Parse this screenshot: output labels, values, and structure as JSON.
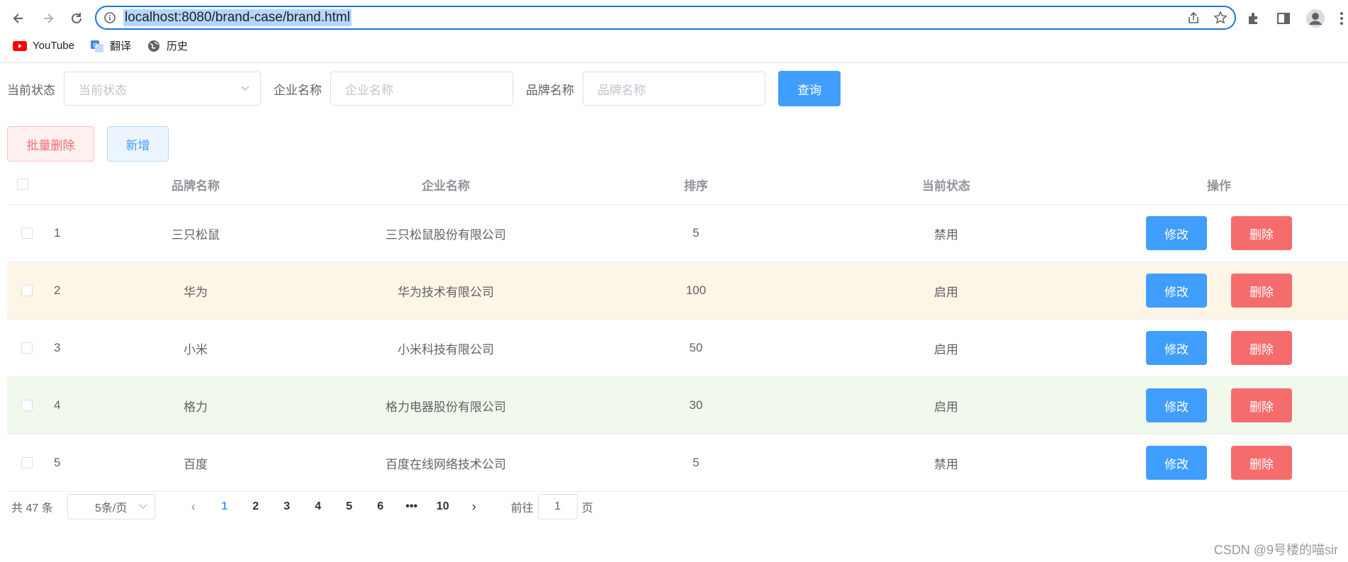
{
  "browser": {
    "url": "localhost:8080/brand-case/brand.html",
    "bookmarks": [
      {
        "label": "YouTube",
        "icon": "youtube-icon"
      },
      {
        "label": "翻译",
        "icon": "translate-icon"
      },
      {
        "label": "历史",
        "icon": "globe-icon"
      }
    ]
  },
  "search_form": {
    "status_label": "当前状态",
    "status_placeholder": "当前状态",
    "company_label": "企业名称",
    "company_placeholder": "企业名称",
    "brand_label": "品牌名称",
    "brand_placeholder": "品牌名称",
    "query_button": "查询"
  },
  "toolbar": {
    "batch_delete": "批量删除",
    "add": "新增"
  },
  "table": {
    "headers": {
      "brand": "品牌名称",
      "company": "企业名称",
      "order": "排序",
      "status": "当前状态",
      "ops": "操作"
    },
    "edit_label": "修改",
    "delete_label": "删除",
    "rows": [
      {
        "index": "1",
        "brand": "三只松鼠",
        "company": "三只松鼠股份有限公司",
        "order": "5",
        "status": "禁用"
      },
      {
        "index": "2",
        "brand": "华为",
        "company": "华为技术有限公司",
        "order": "100",
        "status": "启用"
      },
      {
        "index": "3",
        "brand": "小米",
        "company": "小米科技有限公司",
        "order": "50",
        "status": "启用"
      },
      {
        "index": "4",
        "brand": "格力",
        "company": "格力电器股份有限公司",
        "order": "30",
        "status": "启用"
      },
      {
        "index": "5",
        "brand": "百度",
        "company": "百度在线网络技术公司",
        "order": "5",
        "status": "禁用"
      }
    ]
  },
  "pagination": {
    "total": "共 47 条",
    "page_size": "5条/页",
    "pages": [
      "1",
      "2",
      "3",
      "4",
      "5",
      "6",
      "•••",
      "10"
    ],
    "current": "1",
    "goto_label": "前往",
    "goto_value": "1",
    "page_suffix": "页"
  },
  "watermark": "CSDN @9号楼的喵sir",
  "colors": {
    "primary": "#409eff",
    "danger": "#f56c6c",
    "warning_row": "#fdf5e6",
    "success_row": "#f0f9eb"
  }
}
